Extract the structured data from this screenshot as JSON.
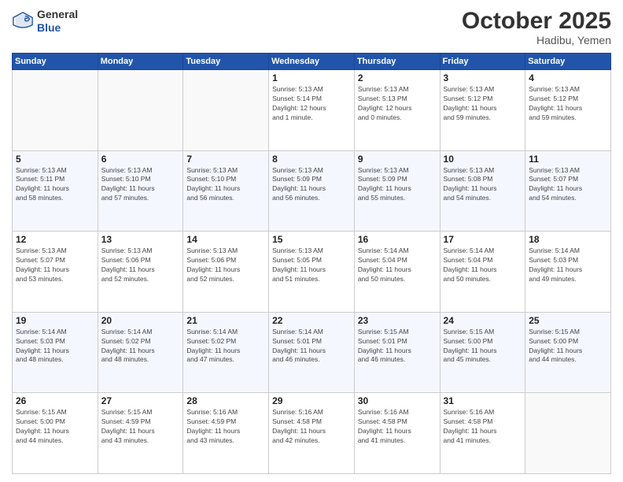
{
  "header": {
    "logo_general": "General",
    "logo_blue": "Blue",
    "month": "October 2025",
    "location": "Hadibu, Yemen"
  },
  "weekdays": [
    "Sunday",
    "Monday",
    "Tuesday",
    "Wednesday",
    "Thursday",
    "Friday",
    "Saturday"
  ],
  "weeks": [
    [
      {
        "day": "",
        "info": ""
      },
      {
        "day": "",
        "info": ""
      },
      {
        "day": "",
        "info": ""
      },
      {
        "day": "1",
        "info": "Sunrise: 5:13 AM\nSunset: 5:14 PM\nDaylight: 12 hours\nand 1 minute."
      },
      {
        "day": "2",
        "info": "Sunrise: 5:13 AM\nSunset: 5:13 PM\nDaylight: 12 hours\nand 0 minutes."
      },
      {
        "day": "3",
        "info": "Sunrise: 5:13 AM\nSunset: 5:12 PM\nDaylight: 11 hours\nand 59 minutes."
      },
      {
        "day": "4",
        "info": "Sunrise: 5:13 AM\nSunset: 5:12 PM\nDaylight: 11 hours\nand 59 minutes."
      }
    ],
    [
      {
        "day": "5",
        "info": "Sunrise: 5:13 AM\nSunset: 5:11 PM\nDaylight: 11 hours\nand 58 minutes."
      },
      {
        "day": "6",
        "info": "Sunrise: 5:13 AM\nSunset: 5:10 PM\nDaylight: 11 hours\nand 57 minutes."
      },
      {
        "day": "7",
        "info": "Sunrise: 5:13 AM\nSunset: 5:10 PM\nDaylight: 11 hours\nand 56 minutes."
      },
      {
        "day": "8",
        "info": "Sunrise: 5:13 AM\nSunset: 5:09 PM\nDaylight: 11 hours\nand 56 minutes."
      },
      {
        "day": "9",
        "info": "Sunrise: 5:13 AM\nSunset: 5:09 PM\nDaylight: 11 hours\nand 55 minutes."
      },
      {
        "day": "10",
        "info": "Sunrise: 5:13 AM\nSunset: 5:08 PM\nDaylight: 11 hours\nand 54 minutes."
      },
      {
        "day": "11",
        "info": "Sunrise: 5:13 AM\nSunset: 5:07 PM\nDaylight: 11 hours\nand 54 minutes."
      }
    ],
    [
      {
        "day": "12",
        "info": "Sunrise: 5:13 AM\nSunset: 5:07 PM\nDaylight: 11 hours\nand 53 minutes."
      },
      {
        "day": "13",
        "info": "Sunrise: 5:13 AM\nSunset: 5:06 PM\nDaylight: 11 hours\nand 52 minutes."
      },
      {
        "day": "14",
        "info": "Sunrise: 5:13 AM\nSunset: 5:06 PM\nDaylight: 11 hours\nand 52 minutes."
      },
      {
        "day": "15",
        "info": "Sunrise: 5:13 AM\nSunset: 5:05 PM\nDaylight: 11 hours\nand 51 minutes."
      },
      {
        "day": "16",
        "info": "Sunrise: 5:14 AM\nSunset: 5:04 PM\nDaylight: 11 hours\nand 50 minutes."
      },
      {
        "day": "17",
        "info": "Sunrise: 5:14 AM\nSunset: 5:04 PM\nDaylight: 11 hours\nand 50 minutes."
      },
      {
        "day": "18",
        "info": "Sunrise: 5:14 AM\nSunset: 5:03 PM\nDaylight: 11 hours\nand 49 minutes."
      }
    ],
    [
      {
        "day": "19",
        "info": "Sunrise: 5:14 AM\nSunset: 5:03 PM\nDaylight: 11 hours\nand 48 minutes."
      },
      {
        "day": "20",
        "info": "Sunrise: 5:14 AM\nSunset: 5:02 PM\nDaylight: 11 hours\nand 48 minutes."
      },
      {
        "day": "21",
        "info": "Sunrise: 5:14 AM\nSunset: 5:02 PM\nDaylight: 11 hours\nand 47 minutes."
      },
      {
        "day": "22",
        "info": "Sunrise: 5:14 AM\nSunset: 5:01 PM\nDaylight: 11 hours\nand 46 minutes."
      },
      {
        "day": "23",
        "info": "Sunrise: 5:15 AM\nSunset: 5:01 PM\nDaylight: 11 hours\nand 46 minutes."
      },
      {
        "day": "24",
        "info": "Sunrise: 5:15 AM\nSunset: 5:00 PM\nDaylight: 11 hours\nand 45 minutes."
      },
      {
        "day": "25",
        "info": "Sunrise: 5:15 AM\nSunset: 5:00 PM\nDaylight: 11 hours\nand 44 minutes."
      }
    ],
    [
      {
        "day": "26",
        "info": "Sunrise: 5:15 AM\nSunset: 5:00 PM\nDaylight: 11 hours\nand 44 minutes."
      },
      {
        "day": "27",
        "info": "Sunrise: 5:15 AM\nSunset: 4:59 PM\nDaylight: 11 hours\nand 43 minutes."
      },
      {
        "day": "28",
        "info": "Sunrise: 5:16 AM\nSunset: 4:59 PM\nDaylight: 11 hours\nand 43 minutes."
      },
      {
        "day": "29",
        "info": "Sunrise: 5:16 AM\nSunset: 4:58 PM\nDaylight: 11 hours\nand 42 minutes."
      },
      {
        "day": "30",
        "info": "Sunrise: 5:16 AM\nSunset: 4:58 PM\nDaylight: 11 hours\nand 41 minutes."
      },
      {
        "day": "31",
        "info": "Sunrise: 5:16 AM\nSunset: 4:58 PM\nDaylight: 11 hours\nand 41 minutes."
      },
      {
        "day": "",
        "info": ""
      }
    ]
  ]
}
